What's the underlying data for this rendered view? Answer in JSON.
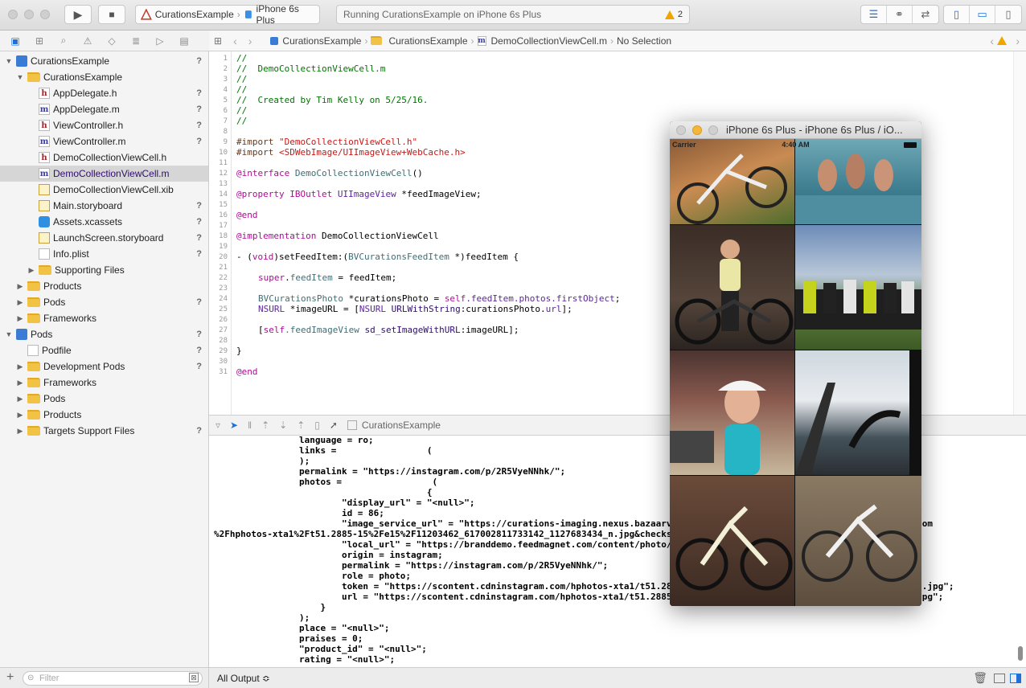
{
  "toolbar": {
    "scheme_project": "CurationsExample",
    "scheme_device": "iPhone 6s Plus",
    "activity_text": "Running CurationsExample on iPhone 6s Plus",
    "warning_count": "2",
    "play_glyph": "▶",
    "stop_glyph": "■"
  },
  "navigator": {
    "tree": [
      {
        "label": "CurationsExample",
        "kind": "project",
        "depth": 0,
        "disc": "▼",
        "status": "?"
      },
      {
        "label": "CurationsExample",
        "kind": "folder",
        "depth": 1,
        "disc": "▼",
        "status": ""
      },
      {
        "label": "AppDelegate.h",
        "kind": "h",
        "depth": 2,
        "disc": "",
        "status": "?"
      },
      {
        "label": "AppDelegate.m",
        "kind": "m",
        "depth": 2,
        "disc": "",
        "status": "?"
      },
      {
        "label": "ViewController.h",
        "kind": "h",
        "depth": 2,
        "disc": "",
        "status": "?"
      },
      {
        "label": "ViewController.m",
        "kind": "m",
        "depth": 2,
        "disc": "",
        "status": "?"
      },
      {
        "label": "DemoCollectionViewCell.h",
        "kind": "h",
        "depth": 2,
        "disc": "",
        "status": ""
      },
      {
        "label": "DemoCollectionViewCell.m",
        "kind": "m",
        "depth": 2,
        "disc": "",
        "status": "",
        "selected": true
      },
      {
        "label": "DemoCollectionViewCell.xib",
        "kind": "y",
        "depth": 2,
        "disc": "",
        "status": ""
      },
      {
        "label": "Main.storyboard",
        "kind": "y",
        "depth": 2,
        "disc": "",
        "status": "?"
      },
      {
        "label": "Assets.xcassets",
        "kind": "b",
        "depth": 2,
        "disc": "",
        "status": "?"
      },
      {
        "label": "LaunchScreen.storyboard",
        "kind": "y",
        "depth": 2,
        "disc": "",
        "status": "?"
      },
      {
        "label": "Info.plist",
        "kind": "g",
        "depth": 2,
        "disc": "",
        "status": "?"
      },
      {
        "label": "Supporting Files",
        "kind": "folder",
        "depth": 2,
        "disc": "▶",
        "status": ""
      },
      {
        "label": "Products",
        "kind": "folder",
        "depth": 1,
        "disc": "▶",
        "status": ""
      },
      {
        "label": "Pods",
        "kind": "folder",
        "depth": 1,
        "disc": "▶",
        "status": "?"
      },
      {
        "label": "Frameworks",
        "kind": "folder",
        "depth": 1,
        "disc": "▶",
        "status": ""
      },
      {
        "label": "Pods",
        "kind": "project",
        "depth": 0,
        "disc": "▼",
        "status": "?"
      },
      {
        "label": "Podfile",
        "kind": "g",
        "depth": 1,
        "disc": "",
        "status": "?"
      },
      {
        "label": "Development Pods",
        "kind": "folder",
        "depth": 1,
        "disc": "▶",
        "status": "?"
      },
      {
        "label": "Frameworks",
        "kind": "folder",
        "depth": 1,
        "disc": "▶",
        "status": ""
      },
      {
        "label": "Pods",
        "kind": "folder",
        "depth": 1,
        "disc": "▶",
        "status": ""
      },
      {
        "label": "Products",
        "kind": "folder",
        "depth": 1,
        "disc": "▶",
        "status": ""
      },
      {
        "label": "Targets Support Files",
        "kind": "folder",
        "depth": 1,
        "disc": "▶",
        "status": "?"
      }
    ],
    "filter_placeholder": "Filter",
    "add_glyph": "+"
  },
  "jumpbar": {
    "crumbs": [
      "CurationsExample",
      "CurationsExample",
      "DemoCollectionViewCell.m",
      "No Selection"
    ]
  },
  "editor": {
    "line_numbers": [
      "1",
      "2",
      "3",
      "4",
      "5",
      "6",
      "7",
      "8",
      "9",
      "10",
      "11",
      "12",
      "13",
      "14",
      "15",
      "16",
      "17",
      "18",
      "19",
      "20",
      "21",
      "22",
      "23",
      "24",
      "25",
      "26",
      "27",
      "28",
      "29",
      "30",
      "31"
    ],
    "comment_lines": [
      "//",
      "//  DemoCollectionViewCell.m",
      "//",
      "//",
      "//  Created by Tim Kelly on 5/25/16.",
      "//",
      "//"
    ],
    "import1_kw": "#import",
    "import1_val": "\"DemoCollectionViewCell.h\"",
    "import2_kw": "#import",
    "import2_val": "<SDWebImage/UIImageView+WebCache.h>",
    "interface_kw": "@interface",
    "interface_name": "DemoCollectionViewCell",
    "interface_rest": "()",
    "property_kw": "@property",
    "property_outlet": "IBOutlet",
    "property_type": "UIImageView",
    "property_name": "*feedImageView;",
    "end1": "@end",
    "impl_kw": "@implementation",
    "impl_name": "DemoCollectionViewCell",
    "method_head_1": "- (",
    "method_void": "void",
    "method_head_2": ")setFeedItem:(",
    "method_type": "BVCurationsFeedItem",
    "method_head_3": " *)feedItem {",
    "l22_super": "super",
    "l22_prop": "feedItem",
    "l22_rest": " = feedItem;",
    "l24_type": "BVCurationsPhoto",
    "l24_mid": " *curationsPhoto = ",
    "l24_self": "self",
    "l24_chain": ".feedItem.photos.firstObject",
    "l24_end": ";",
    "l25_type": "NSURL",
    "l25_mid": " *imageURL = [",
    "l25_cls": "NSURL",
    "l25_sel": "URLWithString",
    "l25_rest": ":curationsPhoto.",
    "l25_url": "url",
    "l25_end": "];",
    "l27_open": "[",
    "l27_self": "self",
    "l27_prop": ".feedImageView",
    "l27_sel": " sd_setImageWithURL",
    "l27_rest": ":imageURL];",
    "brace": "}",
    "end2": "@end"
  },
  "debugbar": {
    "target": "CurationsExample"
  },
  "console": {
    "lines": [
      "                language = ro;",
      "                links =                 (",
      "                );",
      "                permalink = \"https://instagram.com/p/2R5VyeNNhk/\";",
      "                photos =                 (",
      "                                        {",
      "                        \"display_url\" = \"<null>\";",
      "                        id = 86;",
      "                        \"image_service_url\" = \"https://curations-imaging.nexus.bazaarv                                           am.com",
      "%2Fhphotos-xta1%2Ft51.2885-15%2Fe15%2F11203462_617002811733142_1127683434_n.jpg&checks",
      "                        \"local_url\" = \"https://branddemo.feedmagnet.com/content/photo/",
      "                        origin = instagram;",
      "                        permalink = \"https://instagram.com/p/2R5VyeNNhk/\";",
      "                        role = photo;",
      "                        token = \"https://scontent.cdninstagram.com/hphotos-xta1/t51.2885-15/e15/11203462_617002811733142_1127683434_n.jpg\";",
      "                        url = \"https://scontent.cdninstagram.com/hphotos-xta1/t51.2885-15/e15/11203462_617002811733142_1127683434_n.jpg\";",
      "                    }",
      "                );",
      "                place = \"<null>\";",
      "                praises = 0;",
      "                \"product_id\" = \"<null>\";",
      "                rating = \"<null>\";"
    ],
    "output_selector": "All Output ≎"
  },
  "simulator": {
    "title": "iPhone 6s Plus - iPhone 6s Plus / iO...",
    "carrier": "Carrier",
    "time": "4:40 AM"
  },
  "colors": {
    "accent": "#1e6fd9",
    "warning": "#f0a500",
    "selection": "#d6d6d6"
  }
}
